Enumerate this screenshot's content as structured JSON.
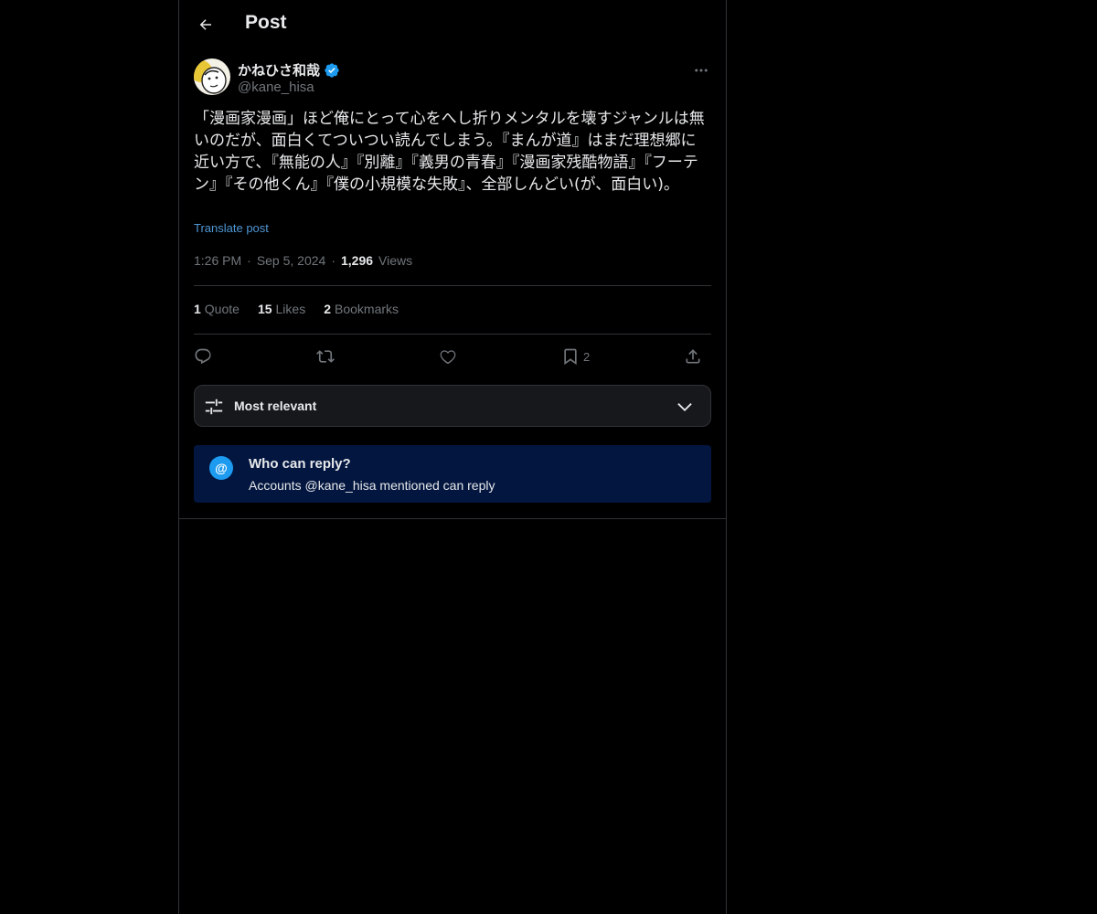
{
  "header": {
    "title": "Post"
  },
  "author": {
    "name": "かねひさ和哉",
    "handle": "@kane_hisa"
  },
  "post": {
    "text": "「漫画家漫画」ほど俺にとって心をへし折りメンタルを壊すジャンルは無いのだが、面白くてついつい読んでしまう。『まんが道』はまだ理想郷に近い方で、『無能の人』『別離』『義男の青春』『漫画家残酷物語』『フーテン』『その他くん』『僕の小規模な失敗』、全部しんどい(が、面白い)。",
    "translate_label": "Translate post"
  },
  "meta": {
    "time": "1:26 PM",
    "date": "Sep 5, 2024",
    "views_count": "1,296",
    "views_label": "Views",
    "separator": "·"
  },
  "stats": {
    "quotes_count": "1",
    "quotes_label": "Quote",
    "likes_count": "15",
    "likes_label": "Likes",
    "bookmarks_count": "2",
    "bookmarks_label": "Bookmarks"
  },
  "actions": {
    "reply_icon": "reply-icon",
    "repost_icon": "repost-icon",
    "like_icon": "heart-icon",
    "bookmark_icon": "bookmark-icon",
    "bookmark_count": "2",
    "share_icon": "share-icon"
  },
  "sort": {
    "label": "Most relevant"
  },
  "reply_restriction": {
    "icon": "@",
    "title": "Who can reply?",
    "subtitle": "Accounts @kane_hisa mentioned can reply"
  },
  "colors": {
    "background": "#000000",
    "accent": "#1d9bf0",
    "border": "#2f3336",
    "muted": "#71767b",
    "reply_box_bg": "#031640"
  }
}
